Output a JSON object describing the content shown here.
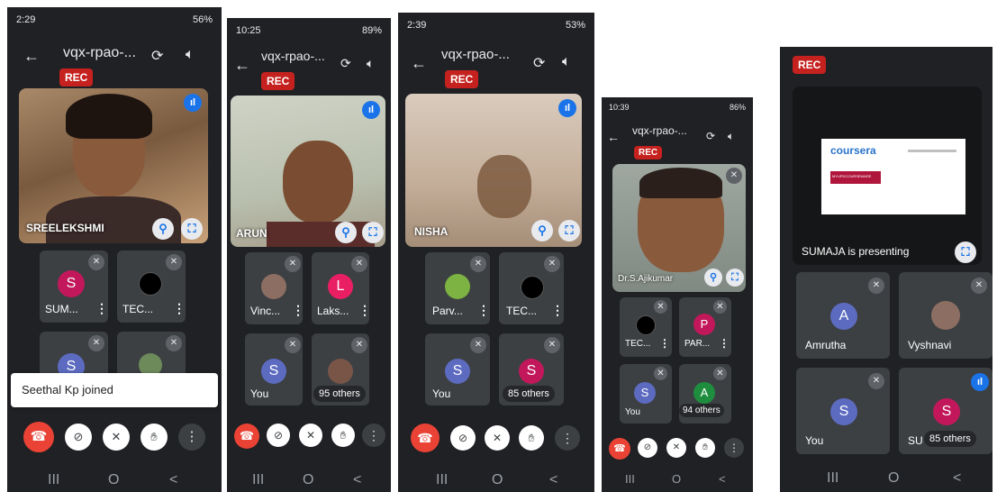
{
  "meeting_title": "vqx-rpao-...",
  "rec_label": "REC",
  "icons": {
    "back": "back-arrow-icon",
    "switch_camera": "switch-camera-icon",
    "speaker": "speaker-icon",
    "pin": "pin-icon",
    "fullscreen": "fullscreen-icon",
    "mic_off": "mic-off-icon",
    "more": "more-vert-icon",
    "end_call": "end-call-icon",
    "camera_off": "camera-off-icon",
    "hand": "raise-hand-icon",
    "speaking": "speaking-indicator-icon",
    "nav_recents": "nav-recents-icon",
    "nav_home": "nav-home-icon",
    "nav_back": "nav-back-icon"
  },
  "colors": {
    "end_call": "#ea4335",
    "rec": "#c5221f",
    "accent": "#1a73e8",
    "background": "#202124",
    "tile": "#3c4043"
  },
  "nav": {
    "recents": "III",
    "home": "O",
    "back": "<"
  },
  "phone1": {
    "time": "2:29",
    "signal": "56%",
    "main_name": "SREELEKSHMI",
    "tiles": [
      {
        "letter": "S",
        "name": "SUM...",
        "color": "#c2185b"
      },
      {
        "letter": "",
        "name": "TEC...",
        "color": "#000000"
      },
      {
        "letter": "S",
        "name": "",
        "color": "#5c6bc0"
      },
      {
        "letter": "",
        "name": "",
        "color": "#6d8a5a"
      }
    ],
    "toast": "Seethal Kp joined"
  },
  "phone2": {
    "time": "10:25",
    "signal": "89%",
    "main_name": "ARUN",
    "tiles": [
      {
        "letter": "",
        "name": "Vinc...",
        "color": "#8d6e63"
      },
      {
        "letter": "L",
        "name": "Laks...",
        "color": "#e91e63"
      },
      {
        "letter": "S",
        "name": "You",
        "color": "#5c6bc0"
      },
      {
        "letter": "",
        "name": "",
        "color": "#795548"
      }
    ],
    "others": "95 others"
  },
  "phone3": {
    "time": "2:39",
    "signal": "53%",
    "main_name": "NISHA",
    "tiles": [
      {
        "letter": "",
        "name": "Parv...",
        "color": "#7cb342"
      },
      {
        "letter": "",
        "name": "TEC...",
        "color": "#000000"
      },
      {
        "letter": "S",
        "name": "You",
        "color": "#5c6bc0"
      },
      {
        "letter": "S",
        "name": "",
        "color": "#c2185b"
      }
    ],
    "others": "85 others"
  },
  "phone4": {
    "time": "10:39",
    "signal": "86%",
    "main_name": "Dr.S.Ajikumar",
    "tiles": [
      {
        "letter": "",
        "name": "TEC...",
        "color": "#000000"
      },
      {
        "letter": "P",
        "name": "PAR...",
        "color": "#c2185b"
      },
      {
        "letter": "S",
        "name": "You",
        "color": "#5c6bc0"
      },
      {
        "letter": "A",
        "name": "",
        "color": "#1e8e3e"
      }
    ],
    "others": "94 others"
  },
  "phone5": {
    "presenting": "SUMAJA is presenting",
    "slide_brand": "coursera",
    "slide_sub": "MYUPDCOURSEWARE",
    "tiles": [
      {
        "letter": "A",
        "name": "Amrutha",
        "color": "#5c6bc0"
      },
      {
        "letter": "",
        "name": "Vyshnavi",
        "color": "#8d6e63"
      },
      {
        "letter": "S",
        "name": "You",
        "color": "#5c6bc0"
      },
      {
        "letter": "S",
        "name": "SU",
        "color": "#c2185b"
      }
    ],
    "others": "85 others"
  }
}
